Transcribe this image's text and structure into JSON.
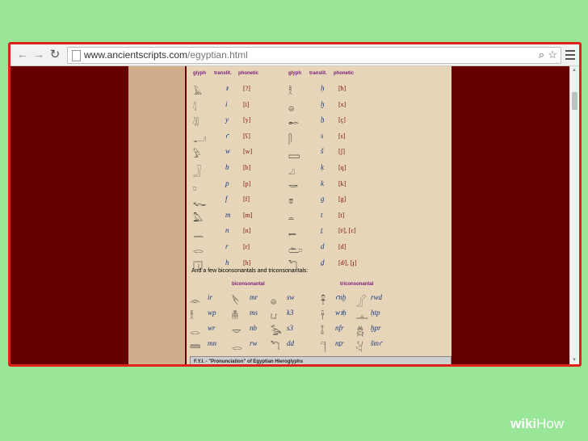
{
  "browser": {
    "url_host": "www.ancientscripts.com",
    "url_path": "/egyptian.html"
  },
  "table": {
    "headers": [
      "glyph",
      "translit.",
      "phonetic"
    ],
    "left": [
      {
        "glyph": "𓄿",
        "translit": "ꜣ",
        "phonetic": "[?]"
      },
      {
        "glyph": "𓇋",
        "translit": "i",
        "phonetic": "[i]"
      },
      {
        "glyph": "𓇌",
        "translit": "y",
        "phonetic": "[y]"
      },
      {
        "glyph": "𓂝",
        "translit": "ꜥ",
        "phonetic": "[ʕ]"
      },
      {
        "glyph": "𓅱",
        "translit": "w",
        "phonetic": "[w]"
      },
      {
        "glyph": "𓃀",
        "translit": "b",
        "phonetic": "[b]"
      },
      {
        "glyph": "𓊪",
        "translit": "p",
        "phonetic": "[p]"
      },
      {
        "glyph": "𓆑",
        "translit": "f",
        "phonetic": "[f]"
      },
      {
        "glyph": "𓅓",
        "translit": "m",
        "phonetic": "[m]"
      },
      {
        "glyph": "𓈖",
        "translit": "n",
        "phonetic": "[n]"
      },
      {
        "glyph": "𓂋",
        "translit": "r",
        "phonetic": "[r]"
      },
      {
        "glyph": "𓉔",
        "translit": "h",
        "phonetic": "[h]"
      }
    ],
    "right": [
      {
        "glyph": "𓎛",
        "translit": "ḥ",
        "phonetic": "[ħ]"
      },
      {
        "glyph": "𓐍",
        "translit": "ḫ",
        "phonetic": "[x]"
      },
      {
        "glyph": "𓄡",
        "translit": "ẖ",
        "phonetic": "[ç]"
      },
      {
        "glyph": "𓋴",
        "translit": "s",
        "phonetic": "[s]"
      },
      {
        "glyph": "𓈙",
        "translit": "š",
        "phonetic": "[ʃ]"
      },
      {
        "glyph": "𓈎",
        "translit": "ḳ",
        "phonetic": "[q]"
      },
      {
        "glyph": "𓎡",
        "translit": "k",
        "phonetic": "[k]"
      },
      {
        "glyph": "𓎼",
        "translit": "g",
        "phonetic": "[g]"
      },
      {
        "glyph": "𓏏",
        "translit": "t",
        "phonetic": "[t]"
      },
      {
        "glyph": "𓍿",
        "translit": "ṯ",
        "phonetic": "[tʲ], [c]"
      },
      {
        "glyph": "𓂧",
        "translit": "d",
        "phonetic": "[d]"
      },
      {
        "glyph": "𓆓",
        "translit": "ḏ",
        "phonetic": "[dʲ], [ɟ]"
      }
    ]
  },
  "section2": {
    "subtitle": "And a few biconsonantals and triconsonantals:",
    "bi_header": "biconsonantal",
    "tri_header": "triconsonantal",
    "bi_col1": [
      {
        "glyph": "𓁹",
        "tr": "ir"
      },
      {
        "glyph": "𓎛",
        "tr": "wp"
      },
      {
        "glyph": "𓂋",
        "tr": "wr"
      },
      {
        "glyph": "𓏠",
        "tr": "mn"
      }
    ],
    "bi_col2": [
      {
        "glyph": "𓌸",
        "tr": "mr"
      },
      {
        "glyph": "𓄟",
        "tr": "ms"
      },
      {
        "glyph": "𓎟",
        "tr": "nb"
      },
      {
        "glyph": "𓂋",
        "tr": "rw"
      }
    ],
    "bi_col3": [
      {
        "glyph": "𓐍",
        "tr": "sw"
      },
      {
        "glyph": "𓂓",
        "tr": "k3"
      },
      {
        "glyph": "𓅭",
        "tr": "s3"
      },
      {
        "glyph": "𓆓",
        "tr": "dd"
      }
    ],
    "tri_col1": [
      {
        "glyph": "𓋹",
        "tr": "ꜥnḫ"
      },
      {
        "glyph": "𓌂",
        "tr": "wꜣḥ"
      },
      {
        "glyph": "𓄤",
        "tr": "nfr"
      },
      {
        "glyph": "𓊹",
        "tr": "nṯr"
      }
    ],
    "tri_col2": [
      {
        "glyph": "𓂾",
        "tr": "rwd"
      },
      {
        "glyph": "𓊵",
        "tr": "ḥtp"
      },
      {
        "glyph": "𓆣",
        "tr": "ḫpr"
      },
      {
        "glyph": "𓋔",
        "tr": "šmꜥ"
      }
    ]
  },
  "footer_box": "F.Y.I. - \"Pronunciation\" of Egyptian Hieroglyphs",
  "watermark": {
    "wiki": "wiki",
    "how": "How"
  }
}
